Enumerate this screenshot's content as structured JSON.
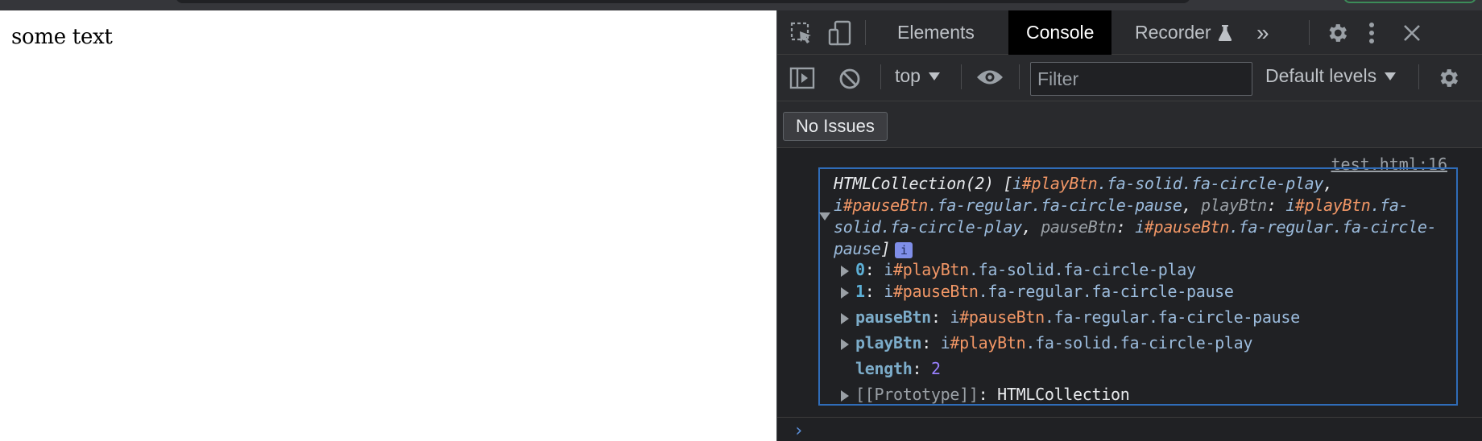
{
  "page": {
    "text": "some text"
  },
  "devtools": {
    "tabs": [
      {
        "label": "Elements",
        "active": false
      },
      {
        "label": "Console",
        "active": true
      },
      {
        "label": "Recorder",
        "active": false
      }
    ],
    "more_tabs_glyph": "»",
    "toolbar_icons": [
      "inspect-element-icon",
      "device-toolbar-icon",
      "settings-icon",
      "kebab-menu-icon",
      "close-icon"
    ],
    "console_toolbar": {
      "context": "top",
      "filter_placeholder": "Filter",
      "levels": "Default levels"
    },
    "issues_label": "No Issues",
    "accent_border": "#2f6cb8",
    "console": {
      "source": "test.html:16",
      "summary": {
        "prefix": "HTMLCollection(2) [",
        "s1_tag": "i",
        "s1_id": "#playBtn",
        "s1_cls": ".fa-solid.fa-circle-play",
        "s2_tag": "i",
        "s2_id": "#pauseBtn",
        "s2_cls": ".fa-regular.fa-circle-pause",
        "k1": "playBtn",
        "s3_tag": "i",
        "s3_id": "#playBtn",
        "s3_cls": ".fa-solid.fa-circle-play",
        "k2": "pauseBtn",
        "s4_tag": "i",
        "s4_id": "#pauseBtn",
        "s4_cls": ".fa-regular.fa-circle-pause",
        "suffix": "]",
        "info": "i"
      },
      "props": [
        {
          "key": "0",
          "tag": "i",
          "id": "#playBtn",
          "cls": ".fa-solid.fa-circle-play"
        },
        {
          "key": "1",
          "tag": "i",
          "id": "#pauseBtn",
          "cls": ".fa-regular.fa-circle-pause"
        },
        {
          "key": "pauseBtn",
          "tag": "i",
          "id": "#pauseBtn",
          "cls": ".fa-regular.fa-circle-pause"
        },
        {
          "key": "playBtn",
          "tag": "i",
          "id": "#playBtn",
          "cls": ".fa-solid.fa-circle-play"
        }
      ],
      "length_key": "length",
      "length_value": "2",
      "proto_key": "[[Prototype]]",
      "proto_value": "HTMLCollection"
    },
    "prompt": "›"
  }
}
